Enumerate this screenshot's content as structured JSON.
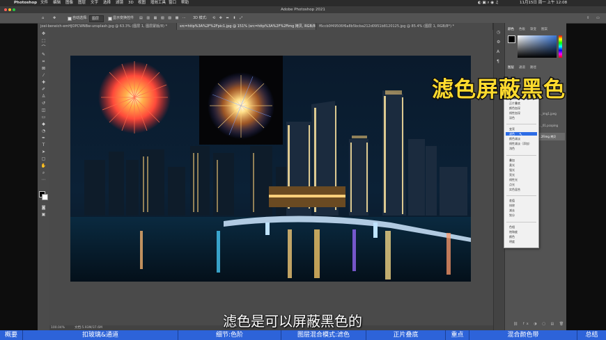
{
  "menubar": {
    "app": "Photoshop",
    "items": [
      "文件",
      "编辑",
      "图像",
      "图层",
      "文字",
      "选择",
      "滤镜",
      "3D",
      "视图",
      "增效工具",
      "窗口",
      "帮助"
    ],
    "clock": "11月15日 周一 上午 12:08"
  },
  "window": {
    "title": "Adobe Photoshop 2021"
  },
  "options": {
    "auto_select": "自动选择:",
    "layer_select": "图层",
    "show_transform": "显示变换控件"
  },
  "tabs": [
    {
      "label": "joel-beneich-emHJOPCWNBw-unsplash.jpg @ 63.3% (图层 1, 图层蒙版/8) *"
    },
    {
      "label": "src=http%3A%2F%2Fpic1.jpg @ 151% (src=http%3A%2F%2Fimg 拷贝, RGB/8#) *"
    },
    {
      "label": "f6ccb0f49506f6a8b5bcba212d0951b8120125.jpg @ 85.4% (图层 1, RGB/8*) *"
    }
  ],
  "status": {
    "zoom": "100.04%",
    "doc": "文档:5.93M/37.6M"
  },
  "panels": {
    "top_tabs": [
      "颜色",
      "色板",
      "渐变",
      "图案"
    ],
    "layer_tabs": [
      "图层",
      "通道",
      "路径"
    ],
    "layers": [
      "..._img1.jpeg",
      "..._01.pcoping",
      "...2Fimg 拷贝"
    ]
  },
  "blend_menu": {
    "groups": [
      [
        "正片叠底",
        "颜色加深",
        "线性加深",
        "深色"
      ],
      [
        "变亮",
        "滤色",
        "颜色减淡",
        "线性减淡（添加）",
        "浅色"
      ],
      [
        "叠加",
        "柔光",
        "强光",
        "亮光",
        "线性光",
        "点光",
        "实色混合"
      ],
      [
        "差值",
        "排除",
        "减去",
        "划分"
      ],
      [
        "色相",
        "饱和度",
        "颜色",
        "明度"
      ]
    ],
    "selected": "滤色"
  },
  "overlay": {
    "title": "滤色屏蔽黑色",
    "subtitle": "滤色是可以屏蔽黑色的"
  },
  "chapters": [
    "概要",
    "扣玻璃&通道",
    "细节:色阶",
    "图层混合模式:滤色",
    "正片叠底",
    "重点",
    "混合颜色带",
    "总结"
  ],
  "colors": {
    "chapter_bar": "#2d63d9",
    "title_yellow": "#ffdb2e",
    "selection_blue": "#2c6ce6"
  }
}
